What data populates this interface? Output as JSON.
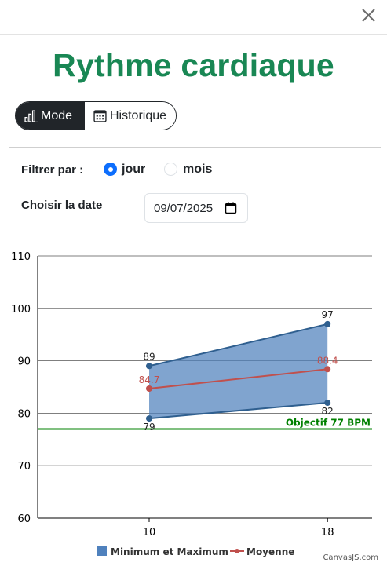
{
  "window": {
    "close_icon": "close-icon"
  },
  "page": {
    "title": "Rythme cardiaque"
  },
  "view_toggle": {
    "mode_label": "Mode",
    "mode_icon": "bar-chart-icon",
    "history_label": "Historique",
    "history_icon": "calendar-icon",
    "active": "Mode"
  },
  "filter": {
    "label": "Filtrer par :",
    "options": [
      {
        "label": "jour",
        "selected": true
      },
      {
        "label": "mois",
        "selected": false
      }
    ]
  },
  "date_picker": {
    "label": "Choisir la date",
    "value": "09/07/2025"
  },
  "chart_data": {
    "type": "line",
    "x": [
      10,
      18
    ],
    "ylim": [
      60,
      110
    ],
    "yticks": [
      60,
      70,
      80,
      90,
      100,
      110
    ],
    "xticks": [
      10,
      18
    ],
    "grid": true,
    "series": [
      {
        "name": "Minimum et Maximum",
        "kind": "range-area",
        "color": "#4f81bd",
        "min": [
          79,
          82
        ],
        "max": [
          89,
          97
        ]
      },
      {
        "name": "Moyenne",
        "kind": "line",
        "color": "#c0504d",
        "values": [
          84.7,
          88.4
        ]
      }
    ],
    "labels": {
      "min": [
        "79",
        "82"
      ],
      "max": [
        "89",
        "97"
      ],
      "mean": [
        "84.7",
        "88.4"
      ]
    },
    "goal": {
      "value": 77,
      "label": "Objectif 77 BPM",
      "color": "#008000"
    },
    "legend_position": "bottom-center"
  },
  "credit": "CanvasJS.com",
  "colors": {
    "title": "#198754",
    "accent": "#0d6efd",
    "dark": "#212529"
  }
}
